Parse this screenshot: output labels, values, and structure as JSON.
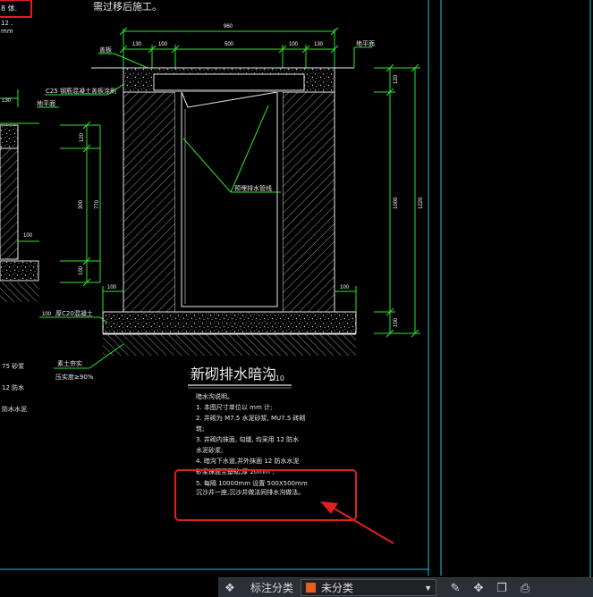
{
  "drawing": {
    "header_note": "需过移后施工。",
    "top_left_fragment": "8  体.",
    "left_fragment_2": "12 .",
    "left_fragment_3": "mm",
    "title": "新砌排水暗沟",
    "scale": "1:10",
    "labels": {
      "gaiban": "盖板",
      "c25": "C25 钢筋混凝土盖板涂刷",
      "ground_left": "地平面",
      "ground_right": "地平面",
      "pipe": "预埋排水管线",
      "c20": "厚C20混凝土",
      "soil": "素土夯实\n压实度≥90%"
    },
    "dims": {
      "top_total": "960",
      "top_parts": [
        "130",
        "100",
        "500",
        "100",
        "130"
      ],
      "right_parts": [
        "120",
        "1000",
        "100"
      ],
      "right_total": "1220",
      "left_h1": "120",
      "left_h2": "300",
      "left_h3": "100",
      "left_total": "770",
      "bottom_left": "100",
      "bottom_right": "100",
      "base_left": "100",
      "left_edge_1": "130",
      "left_edge_2": "100"
    },
    "left_notes": [
      "75  砂浆",
      "12  防水",
      "防水水泥"
    ],
    "notes_heading": "暗水沟说明。",
    "notes": [
      "1. 本图尺寸单位以    mm 计;",
      "2. 井砌为  M7.5  水泥砂浆,  MU7.5  砖砌",
      "筑;",
      "3. 井砌内抹面, 勾缝, 均采用      12    防水",
      "水泥砂浆;",
      "4. 暗沟下水道,井外抹面      12    防水水泥",
      "砂浆抹面至基础,厚    20mm    ;",
      "5. 每隔  10000mm      设置   500X500mm",
      "   沉沙井一座,沉沙井做法同排水沟做法。"
    ]
  },
  "statusbar": {
    "annotation_label": "标注分类",
    "category_value": "未分类"
  },
  "colors": {
    "cad_green": "#2ee62e",
    "cad_white": "#e8e8e8",
    "frame_cyan": "#18c9d8",
    "highlight_red": "#e0201f",
    "status_bg": "#2b2f36",
    "swatch_orange": "#e8601c"
  }
}
